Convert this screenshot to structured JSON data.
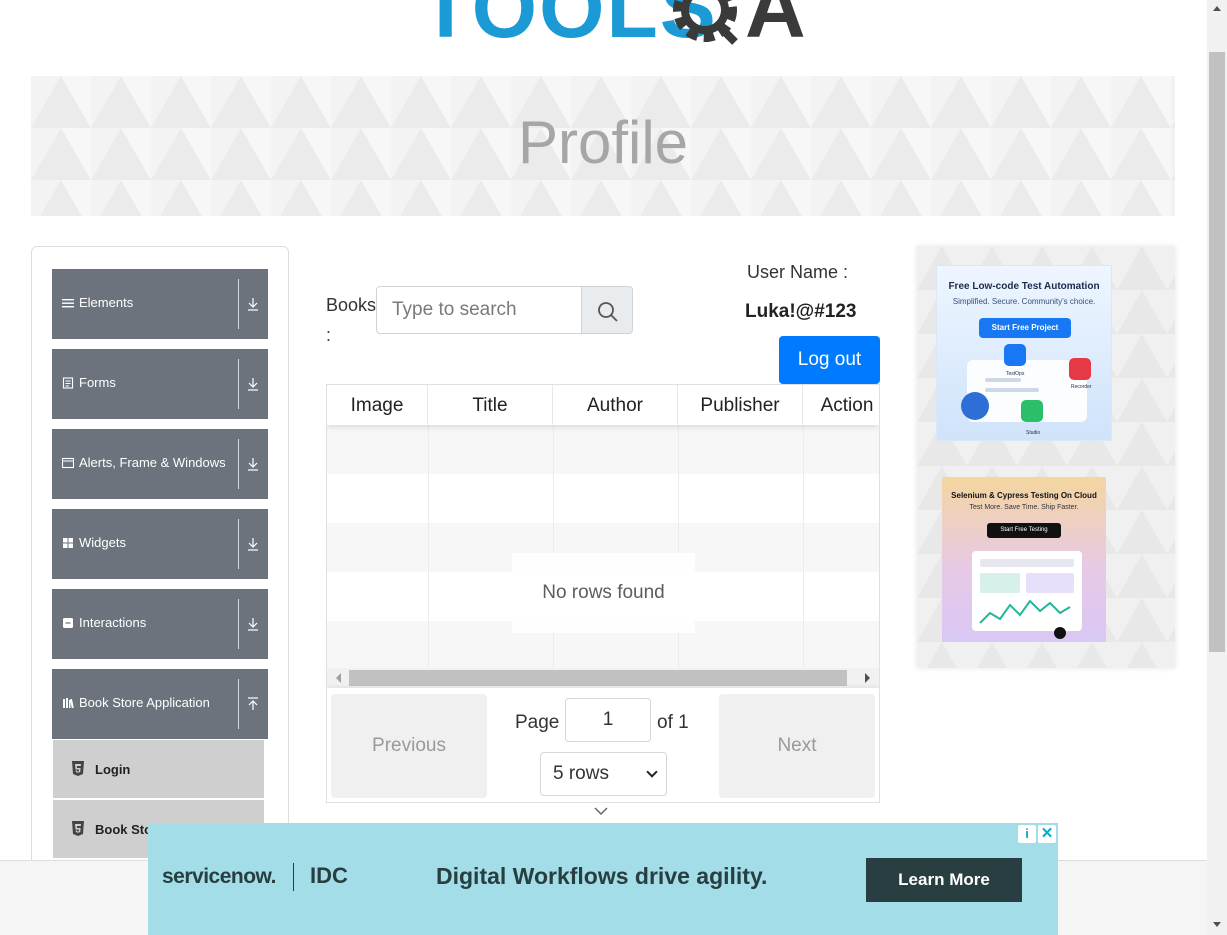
{
  "header": {
    "logo_text": "TOOLSQA",
    "page_title": "Profile"
  },
  "sidebar": {
    "groups": [
      {
        "label": "Elements",
        "icon": "hamburger-icon",
        "expanded": false
      },
      {
        "label": "Forms",
        "icon": "form-icon",
        "expanded": false
      },
      {
        "label": "Alerts, Frame & Windows",
        "icon": "window-icon",
        "expanded": false
      },
      {
        "label": "Widgets",
        "icon": "grid-icon",
        "expanded": false
      },
      {
        "label": "Interactions",
        "icon": "square-icon",
        "expanded": false
      },
      {
        "label": "Book Store Application",
        "icon": "books-icon",
        "expanded": true
      }
    ],
    "subitems": [
      {
        "label": "Login",
        "icon": "html5-icon"
      },
      {
        "label": "Book Sto",
        "icon": "html5-icon"
      }
    ]
  },
  "profile": {
    "books_label": "Books :",
    "search_placeholder": "Type to search",
    "user_name_label": "User Name :",
    "user_name_value": "Luka!@#123",
    "logout_label": "Log out"
  },
  "table": {
    "columns": [
      "Image",
      "Title",
      "Author",
      "Publisher",
      "Action"
    ],
    "empty_message": "No rows found",
    "pagination": {
      "previous_label": "Previous",
      "next_label": "Next",
      "page_label": "Page",
      "page_value": "1",
      "of_label": "of 1",
      "rows_option": "5 rows"
    }
  },
  "ads": {
    "right_top": {
      "headline": "Free Low-code Test Automation",
      "sub": "Simplified. Secure. Community's choice.",
      "cta": "Start Free Project",
      "labels": [
        "TestOps",
        "Recorder",
        "Studio"
      ]
    },
    "right_bottom": {
      "headline": "Selenium & Cypress Testing On Cloud",
      "sub": "Test More. Save Time. Ship Faster.",
      "cta": "Start Free Testing"
    },
    "bottom": {
      "brand1": "servicenow.",
      "brand2": "IDC",
      "headline": "Digital Workflows drive agility.",
      "cta": "Learn More",
      "info": "i",
      "close": "✕"
    }
  },
  "colors": {
    "menu_bg": "#6c737d",
    "submenu_bg": "#cfcfcf",
    "primary": "#007bff",
    "logo_blue": "#1b9ad6",
    "ad_bottom_bg": "#a2dde8"
  }
}
